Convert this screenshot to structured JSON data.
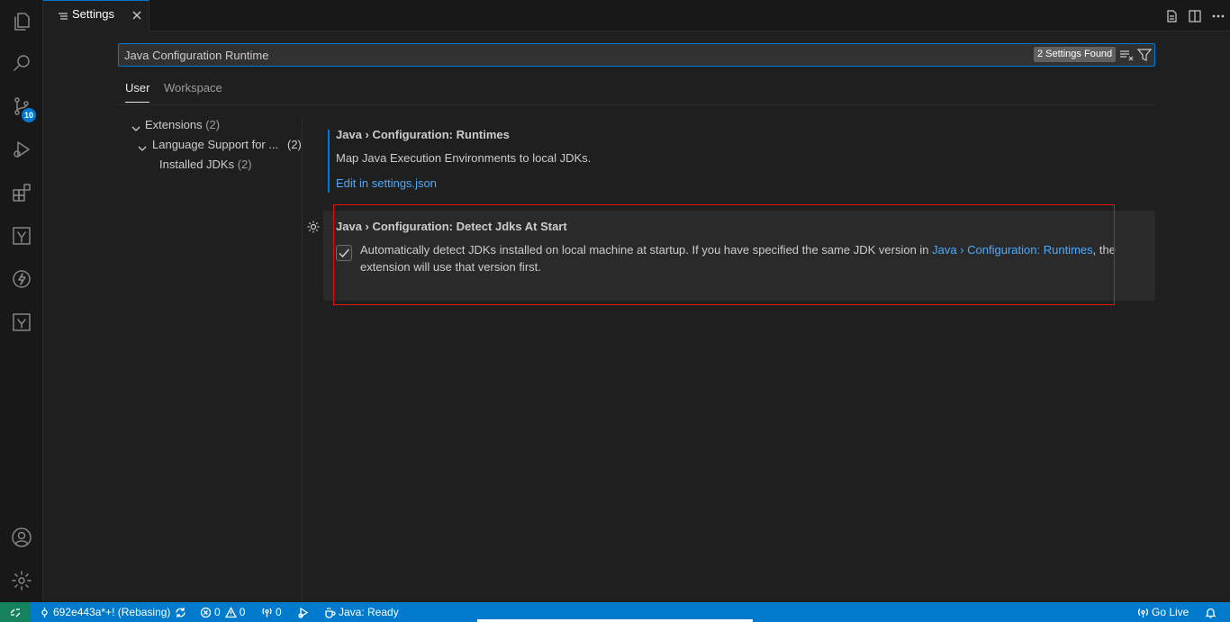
{
  "activity_bar": {
    "items": [
      {
        "name": "explorer-icon"
      },
      {
        "name": "search-icon"
      },
      {
        "name": "source-control-icon",
        "badge": "10"
      },
      {
        "name": "run-debug-icon"
      },
      {
        "name": "extensions-icon"
      },
      {
        "name": "kubernetes-icon"
      },
      {
        "name": "thunder-icon"
      },
      {
        "name": "azure-icon"
      }
    ],
    "bottom": [
      {
        "name": "account-icon"
      },
      {
        "name": "manage-gear-icon"
      }
    ]
  },
  "tab": {
    "label": "Settings"
  },
  "search": {
    "value": "Java Configuration Runtime",
    "found": "2 Settings Found"
  },
  "scopes": {
    "user": "User",
    "workspace": "Workspace"
  },
  "toc": {
    "extensions": {
      "label": "Extensions",
      "count": "(2)"
    },
    "language_support": {
      "label": "Language Support for ...",
      "count": "(2)"
    },
    "installed_jdks": {
      "label": "Installed JDKs",
      "count": "(2)"
    }
  },
  "settings": [
    {
      "category": "Java › Configuration: ",
      "name": "Runtimes",
      "description": "Map Java Execution Environments to local JDKs.",
      "edit_link": "Edit in settings.json"
    },
    {
      "category": "Java › Configuration: ",
      "name": "Detect Jdks At Start",
      "desc_part1": "Automatically detect JDKs installed on local machine at startup. If you have specified the same JDK version in ",
      "desc_link": "Java › Configuration: Runtimes",
      "desc_part2": ", the",
      "desc_line2": "extension will use that version first.",
      "checked": true
    }
  ],
  "status_bar": {
    "branch": "692e443a*+! (Rebasing)",
    "errors": "0",
    "warnings": "0",
    "ports": "0",
    "java": "Java: Ready",
    "go_live": "Go Live"
  }
}
